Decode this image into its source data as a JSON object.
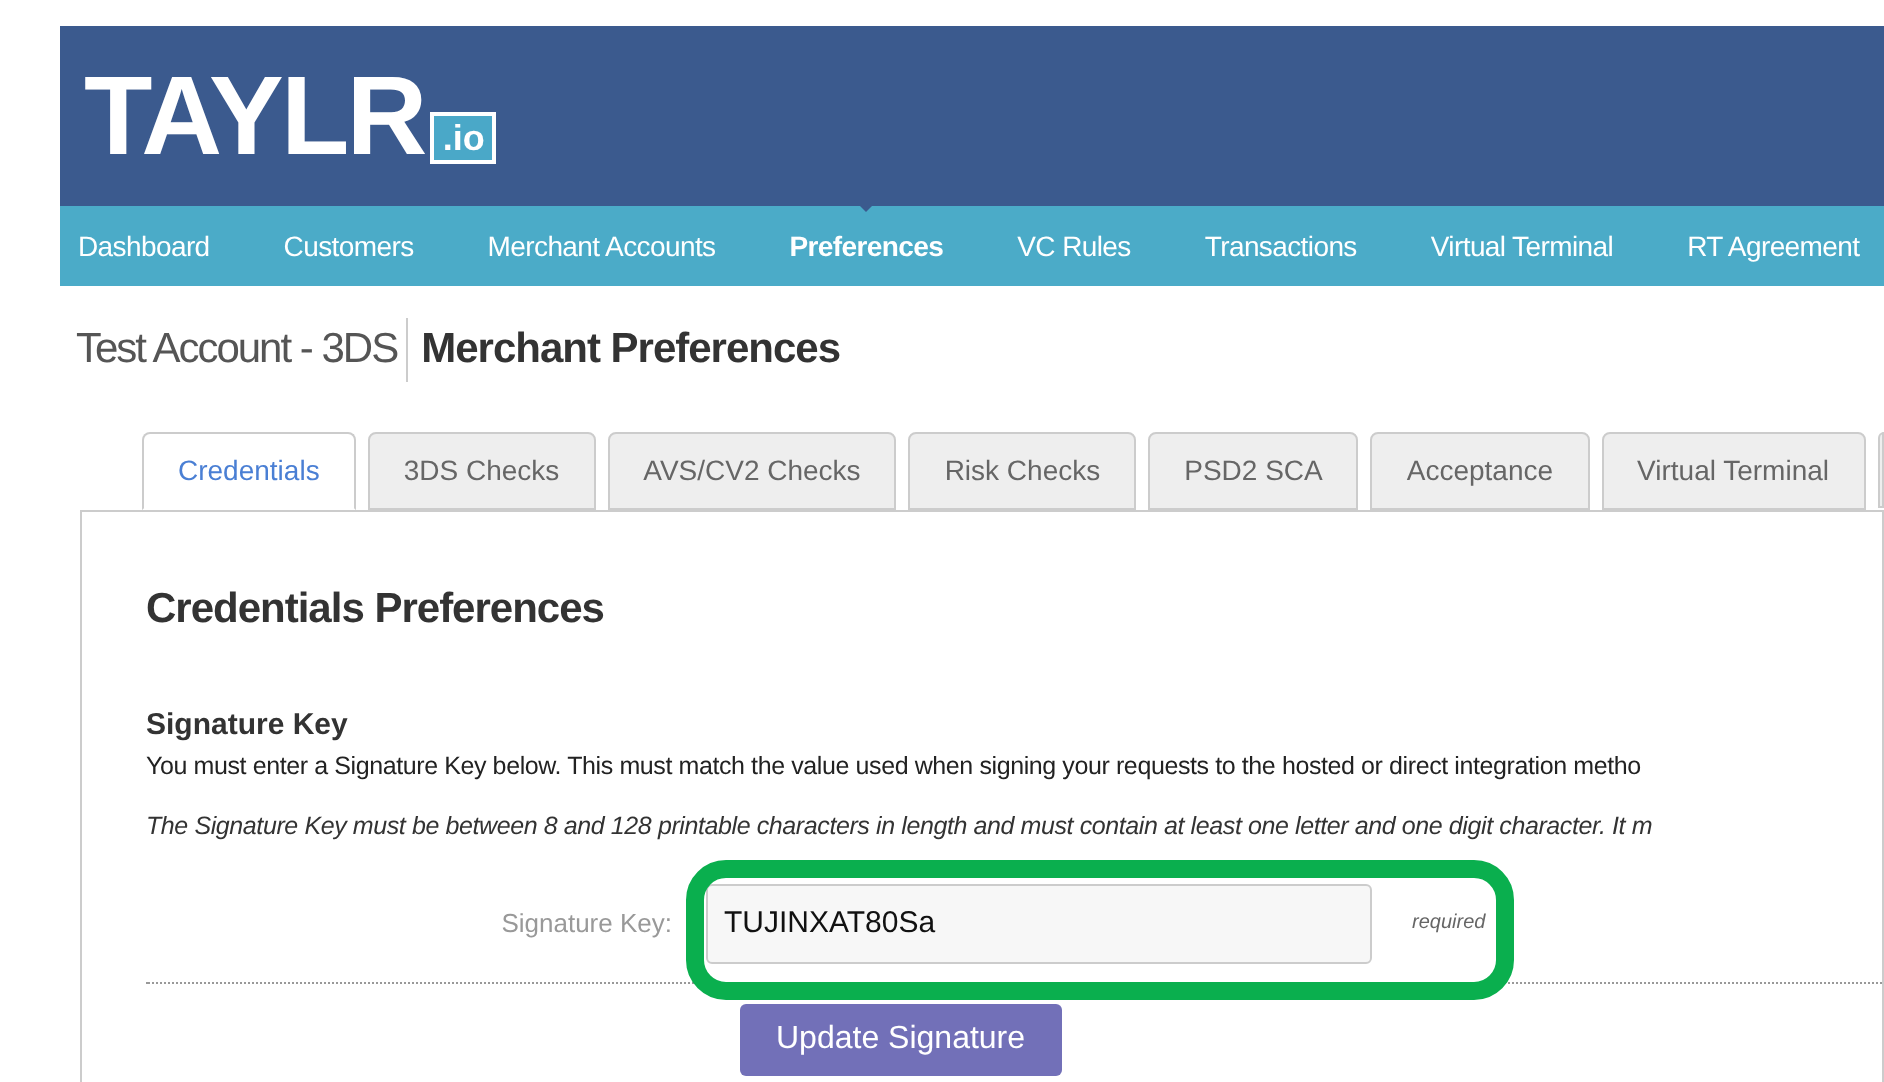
{
  "logo": {
    "text": "TAYLR",
    "badge": ".io"
  },
  "nav": [
    {
      "label": "Dashboard",
      "selected": false
    },
    {
      "label": "Customers",
      "selected": false
    },
    {
      "label": "Merchant Accounts",
      "selected": false
    },
    {
      "label": "Preferences",
      "selected": true
    },
    {
      "label": "VC Rules",
      "selected": false
    },
    {
      "label": "Transactions",
      "selected": false
    },
    {
      "label": "Virtual Terminal",
      "selected": false
    },
    {
      "label": "RT Agreement",
      "selected": false
    }
  ],
  "heading": {
    "account": "Test Account - 3DS",
    "title": "Merchant Preferences"
  },
  "tabs": [
    {
      "label": "Credentials",
      "selected": true
    },
    {
      "label": "3DS Checks",
      "selected": false
    },
    {
      "label": "AVS/CV2 Checks",
      "selected": false
    },
    {
      "label": "Risk Checks",
      "selected": false
    },
    {
      "label": "PSD2 SCA",
      "selected": false
    },
    {
      "label": "Acceptance",
      "selected": false
    },
    {
      "label": "Virtual Terminal",
      "selected": false
    }
  ],
  "panel": {
    "title": "Credentials Preferences",
    "section": "Signature Key",
    "description": "You must enter a Signature Key below. This must match the value used when signing your requests to the hosted or direct integration metho",
    "note": "The Signature Key must be between 8 and 128 printable characters in length and must contain at least one letter and one digit character. It m",
    "field": {
      "label": "Signature Key:",
      "value": "TUJINXAT80Sa",
      "hint": "required"
    },
    "button": "Update Signature"
  }
}
